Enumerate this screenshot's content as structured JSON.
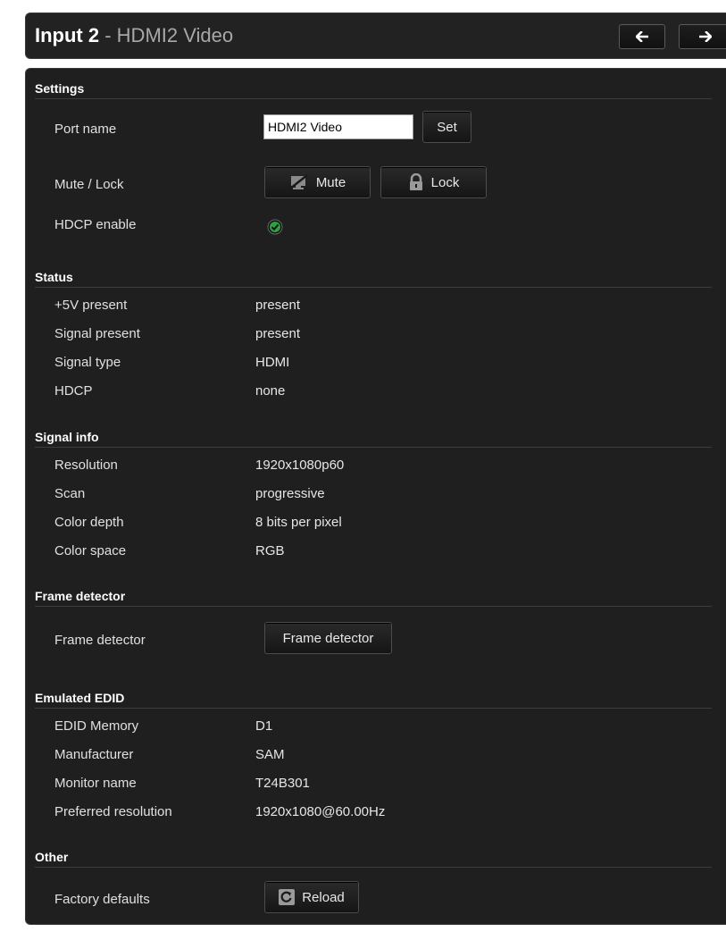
{
  "header": {
    "input_label": "Input 2",
    "separator": " - ",
    "port_name": "HDMI2 Video",
    "prev_icon": "arrow-left-icon",
    "next_icon": "arrow-right-icon"
  },
  "settings": {
    "title": "Settings",
    "port_name_label": "Port name",
    "port_name_value": "HDMI2 Video",
    "set_label": "Set",
    "mute_lock_label": "Mute / Lock",
    "mute_label": "Mute",
    "lock_label": "Lock",
    "hdcp_enable_label": "HDCP enable",
    "hdcp_enabled": true,
    "check_color": "#2ea043"
  },
  "status": {
    "title": "Status",
    "rows": [
      {
        "label": "+5V present",
        "value": "present"
      },
      {
        "label": "Signal present",
        "value": "present"
      },
      {
        "label": "Signal type",
        "value": "HDMI"
      },
      {
        "label": "HDCP",
        "value": "none"
      }
    ]
  },
  "signal_info": {
    "title": "Signal info",
    "rows": [
      {
        "label": "Resolution",
        "value": "1920x1080p60"
      },
      {
        "label": "Scan",
        "value": "progressive"
      },
      {
        "label": "Color depth",
        "value": "8 bits per pixel"
      },
      {
        "label": "Color space",
        "value": "RGB"
      }
    ]
  },
  "frame_detector": {
    "title": "Frame detector",
    "label": "Frame detector",
    "button_label": "Frame detector"
  },
  "emulated_edid": {
    "title": "Emulated EDID",
    "rows": [
      {
        "label": "EDID Memory",
        "value": "D1"
      },
      {
        "label": "Manufacturer",
        "value": "SAM"
      },
      {
        "label": "Monitor name",
        "value": "T24B301"
      },
      {
        "label": "Preferred resolution",
        "value": "1920x1080@60.00Hz"
      }
    ]
  },
  "other": {
    "title": "Other",
    "factory_defaults_label": "Factory defaults",
    "reload_label": "Reload"
  }
}
